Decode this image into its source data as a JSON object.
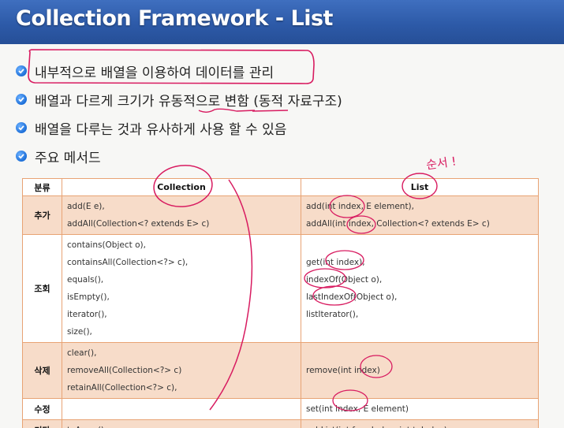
{
  "slide": {
    "title": "Collection Framework - List",
    "bullets": [
      "내부적으로 배열을 이용하여 데이터를 관리",
      "배열과 다르게 크기가 유동적으로 변함 (동적 자료구조)",
      "배열을 다루는 것과 유사하게 사용 할 수 있음",
      "주요 메서드"
    ],
    "handwritten_note": "순서 !",
    "colors": {
      "header": "#2d5aa8",
      "table_border": "#e8a374",
      "row_shade": "#f7dcc9",
      "annotation_ink": "#d81b60"
    }
  },
  "table": {
    "headers": [
      "분류",
      "Collection",
      "List"
    ],
    "rows": [
      {
        "category": "추가",
        "collection": [
          "add(E e),",
          "addAll(Collection<? extends E> c)"
        ],
        "list": [
          "add(int index, E element),",
          "addAll(int index, Collection<? extends E> c)"
        ],
        "shade": true
      },
      {
        "category": "조회",
        "collection": [
          "contains(Object o),",
          "containsAll(Collection<?> c),",
          "equals(),",
          "isEmpty(),",
          "iterator(),",
          "size(),"
        ],
        "list": [
          "get(int index),",
          "indexOf(Object o),",
          "lastIndexOf(Object o),",
          "listIterator(),"
        ],
        "shade": false
      },
      {
        "category": "삭제",
        "collection": [
          "clear(),",
          "removeAll(Collection<?> c)",
          "retainAll(Collection<?> c),"
        ],
        "list": [
          "remove(int index)"
        ],
        "shade": true
      },
      {
        "category": "수정",
        "collection": [],
        "list": [
          "set(int index, E element)"
        ],
        "shade": false
      },
      {
        "category": "기타",
        "collection": [
          "toArray()"
        ],
        "list": [
          "subList(int fromIndex, int toIndex)"
        ],
        "shade": true
      }
    ]
  }
}
